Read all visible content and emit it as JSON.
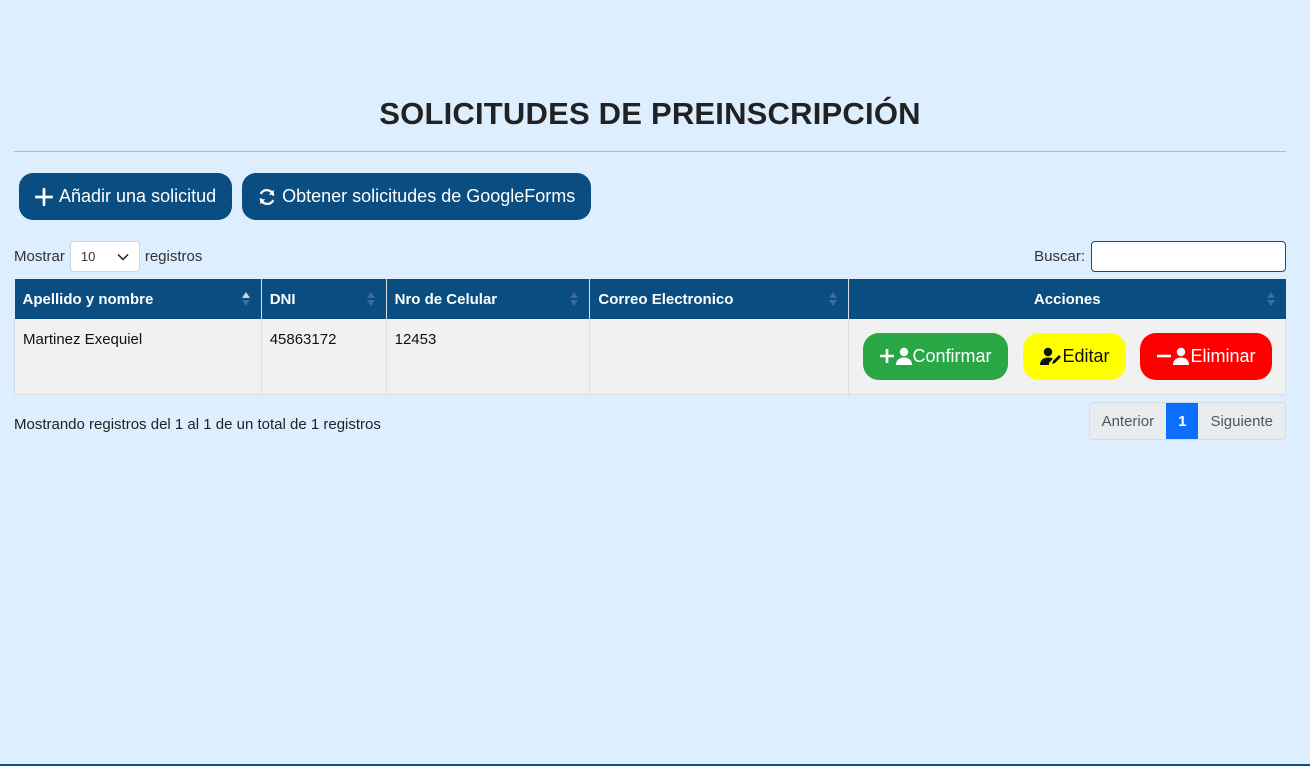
{
  "page": {
    "title": "SOLICITUDES DE PREINSCRIPCIÓN"
  },
  "toolbar": {
    "add_label": "Añadir una solicitud",
    "fetch_label": "Obtener solicitudes de GoogleForms"
  },
  "length_control": {
    "prefix": "Mostrar",
    "value": "10",
    "suffix": "registros"
  },
  "search": {
    "label": "Buscar:",
    "value": ""
  },
  "table": {
    "columns": [
      "Apellido y nombre",
      "DNI",
      "Nro de Celular",
      "Correo Electronico",
      "Acciones"
    ],
    "rows": [
      {
        "name": "Martinez Exequiel",
        "dni": "45863172",
        "phone": "12453",
        "email": ""
      }
    ],
    "actions": {
      "confirm": "Confirmar",
      "edit": "Editar",
      "delete": "Eliminar"
    }
  },
  "footer": {
    "info": "Mostrando registros del 1 al 1 de un total de 1 registros",
    "prev": "Anterior",
    "current_page": "1",
    "next": "Siguiente"
  },
  "colors": {
    "background": "#ddeeff",
    "primary": "#0a4d80",
    "confirm": "#28a745",
    "edit": "#ffff00",
    "delete": "#ff0000",
    "page_active": "#0d6efd"
  }
}
